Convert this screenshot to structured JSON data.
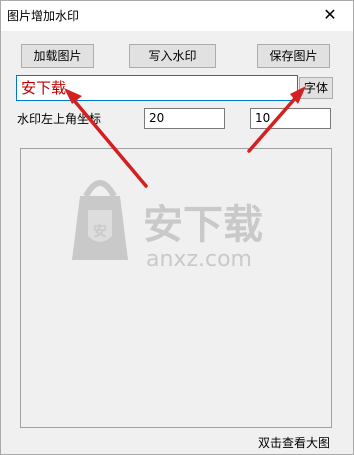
{
  "window": {
    "title": "图片增加水印",
    "close_glyph": "✕"
  },
  "toolbar": {
    "load_image_label": "加载图片",
    "write_watermark_label": "写入水印",
    "save_image_label": "保存图片"
  },
  "watermark_text": {
    "value": "安下载"
  },
  "font_button_label": "字体",
  "coordinates": {
    "label": "水印左上角坐标",
    "x_value": "20",
    "y_value": "10"
  },
  "preview": {
    "hint": "双击查看大图"
  },
  "site_watermark": {
    "text": "安下载",
    "url": "anxz.com",
    "badge_glyph": "安"
  },
  "colors": {
    "arrow": "#d42020",
    "input_focus": "#0078d7",
    "watermark_text": "#c00000"
  }
}
